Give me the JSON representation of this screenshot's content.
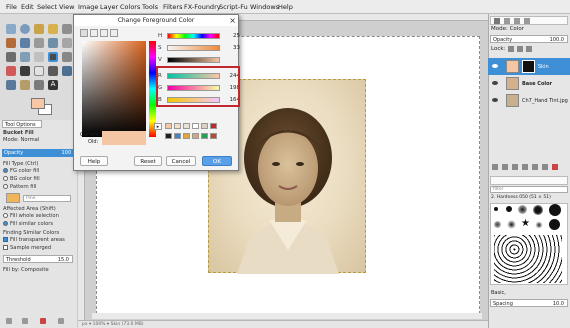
{
  "menubar": [
    "File",
    "Edit",
    "Select",
    "View",
    "Image",
    "Layer",
    "Colors",
    "Tools",
    "Filters",
    "FX-Foundry",
    "Script-Fu",
    "Windows",
    "Help"
  ],
  "dialog": {
    "title": "Change Foreground Color",
    "hsv": [
      {
        "label": "H",
        "value": "25"
      },
      {
        "label": "S",
        "value": "33"
      },
      {
        "label": "V",
        "value": ""
      }
    ],
    "rgb": [
      {
        "label": "R",
        "value": "244"
      },
      {
        "label": "G",
        "value": "198"
      },
      {
        "label": "B",
        "value": "164"
      }
    ],
    "current_label": "Current:",
    "old_label": "Old:",
    "current_color": "#f4c6a4",
    "old_color": "#f4c6a4",
    "buttons": [
      "Help",
      "Reset",
      "Cancel",
      "OK"
    ]
  },
  "tool_options": {
    "tab": "Tool Options",
    "tool_name": "Bucket Fill",
    "mode": "Mode:  Normal",
    "opacity_label": "Opacity",
    "opacity_value": "100",
    "fill_type_label": "Fill Type  (Ctrl)",
    "fill_types": [
      "FG color fill",
      "BG color fill",
      "Pattern fill"
    ],
    "pattern": "Pine",
    "affected_area_label": "Affected Area  (Shift)",
    "affected_areas": [
      "Fill whole selection",
      "Fill similar colors"
    ],
    "finding_label": "Finding Similar Colors",
    "fill_transparent": "Fill transparent areas",
    "sample_merged": "Sample merged",
    "threshold_label": "Threshold",
    "threshold_value": "15.0",
    "fill_by": "Fill by:  Composite"
  },
  "layers": {
    "mode": "Mode:  Color",
    "opacity_label": "Opacity",
    "opacity_value": "100.0",
    "lock_label": "Lock:",
    "items": [
      {
        "name": "Skin"
      },
      {
        "name": "Base Color"
      },
      {
        "name": "Ch7_Hand Tint.jpg"
      }
    ]
  },
  "brushes": {
    "filter": "filter",
    "name": "2. Hardness 050 (51 × 51)",
    "tag": "Basic,",
    "spacing_label": "Spacing",
    "spacing_value": "10.0"
  },
  "statusbar": "px  ▾  100%  ▾   Skin (73.0 MB)"
}
